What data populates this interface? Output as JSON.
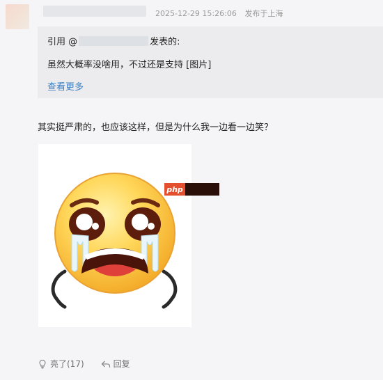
{
  "post": {
    "timestamp": "2025-12-29 15:26:06",
    "location": "发布于上海",
    "text": "其实挺严肃的，也应该这样，但是为什么我一边看一边笑？"
  },
  "quote": {
    "prefix": "引用 @",
    "suffix": "发表的:",
    "body": "虽然大概率没啥用，不过还是支持 [图片]",
    "view_more": "查看更多"
  },
  "image": {
    "icon": "crying-emoji",
    "watermark_text": "php"
  },
  "actions": {
    "like_label": "亮了(17)",
    "reply_label": "回复"
  },
  "colors": {
    "link": "#3b7fc4",
    "watermark": "#e4502d"
  }
}
